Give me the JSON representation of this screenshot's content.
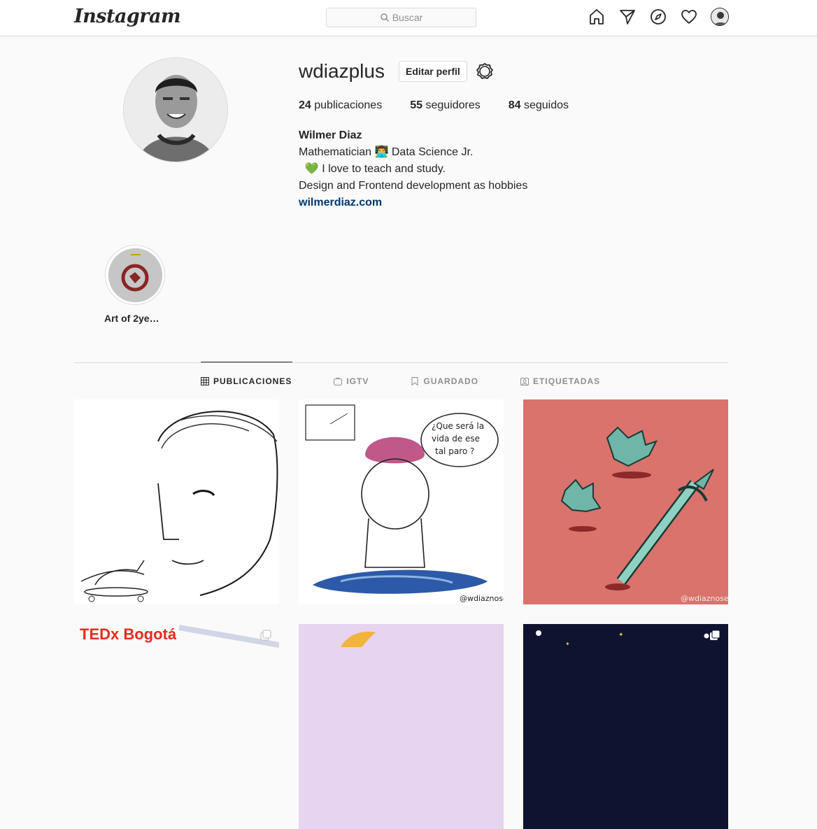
{
  "nav": {
    "logo": "Instagram",
    "search_placeholder": "Buscar",
    "icons": [
      "home-icon",
      "direct-icon",
      "explore-icon",
      "activity-heart-icon",
      "profile-avatar"
    ]
  },
  "profile": {
    "username": "wdiazplus",
    "edit_label": "Editar perfil",
    "stats": {
      "posts_count": "24",
      "posts_label": "publicaciones",
      "followers_count": "55",
      "followers_label": "seguidores",
      "following_count": "84",
      "following_label": "seguidos"
    },
    "name": "Wilmer Diaz",
    "bio_lines": [
      "Mathematician 👨‍💻 Data Science Jr.",
      "  💚 I love to teach and study.",
      "Design and Frontend development as hobbies"
    ],
    "link": "wilmerdiaz.com"
  },
  "highlights": [
    {
      "label": "Art of 2ye…"
    }
  ],
  "tabs": [
    {
      "label": "PUBLICACIONES",
      "icon": "grid-icon",
      "active": true
    },
    {
      "label": "IGTV",
      "icon": "igtv-icon",
      "active": false
    },
    {
      "label": "GUARDADO",
      "icon": "bookmark-icon",
      "active": false
    },
    {
      "label": "ETIQUETADAS",
      "icon": "tagged-icon",
      "active": false
    }
  ],
  "posts": {
    "row1": [
      {
        "watermark": ""
      },
      {
        "speech": "¿Que será la vida de ese tal paro ?",
        "watermark": "@wdiaznose"
      },
      {
        "watermark": "@wdiaznose"
      }
    ],
    "row2": [
      {
        "text": "TEDx Bogotá",
        "multi": true
      },
      {
        "multi": false
      },
      {
        "multi": true
      }
    ]
  },
  "colors": {
    "accent_link": "#00376b",
    "border": "#dbdbdb",
    "muted": "#8e8e8e",
    "post3_bg": "#d9736b",
    "post6_bg": "#0e1330",
    "post5_bg": "#e7d4f0"
  }
}
